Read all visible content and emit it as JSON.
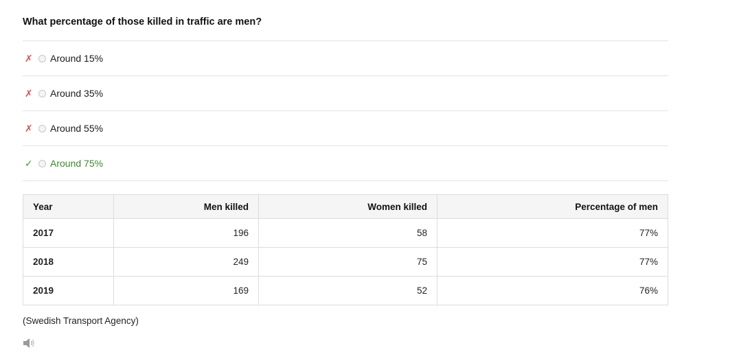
{
  "question": "What percentage of those killed in traffic are men?",
  "options": [
    {
      "mark": "✗",
      "label": "Around 15%",
      "correct": false
    },
    {
      "mark": "✗",
      "label": "Around 35%",
      "correct": false
    },
    {
      "mark": "✗",
      "label": "Around 55%",
      "correct": false
    },
    {
      "mark": "✓",
      "label": "Around 75%",
      "correct": true
    }
  ],
  "table": {
    "headers": [
      "Year",
      "Men killed",
      "Women killed",
      "Percentage of men"
    ],
    "rows": [
      [
        "2017",
        "196",
        "58",
        "77%"
      ],
      [
        "2018",
        "249",
        "75",
        "77%"
      ],
      [
        "2019",
        "169",
        "52",
        "76%"
      ]
    ]
  },
  "source": "(Swedish Transport Agency)",
  "audio_icon": "speaker-icon",
  "colors": {
    "wrong": "#d9534f",
    "correct": "#3a8a2a"
  }
}
